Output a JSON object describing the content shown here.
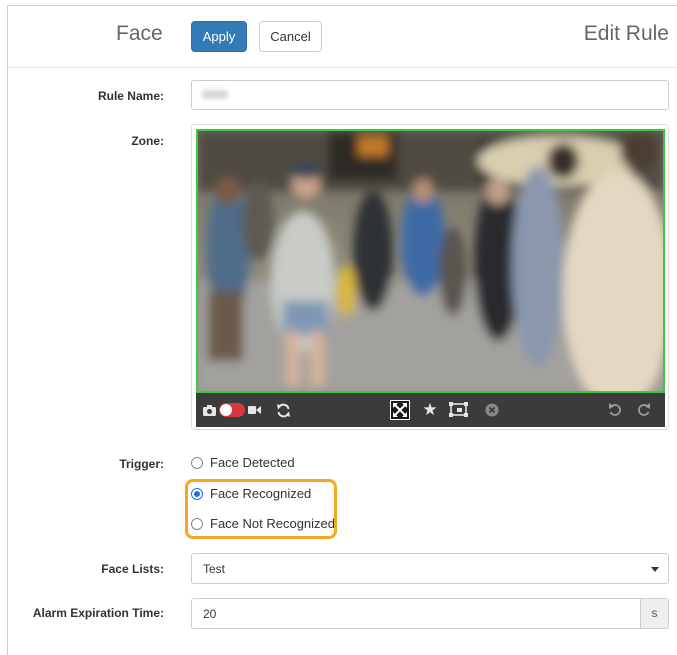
{
  "header": {
    "title": "Face",
    "apply_label": "Apply",
    "cancel_label": "Cancel",
    "mode_title": "Edit Rule"
  },
  "form": {
    "rule_name_label": "Rule Name:",
    "rule_name_value": "",
    "zone_label": "Zone:",
    "trigger_label": "Trigger:",
    "trigger_options": [
      {
        "label": "Face Detected",
        "selected": false
      },
      {
        "label": "Face Recognized",
        "selected": true
      },
      {
        "label": "Face Not Recognized",
        "selected": false
      }
    ],
    "face_lists_label": "Face Lists:",
    "face_lists_value": "Test",
    "alarm_label": "Alarm Expiration Time:",
    "alarm_value": "20",
    "alarm_unit": "s"
  },
  "zone_toolbar": {
    "left_icons": [
      "camera-icon",
      "record-toggle-icon",
      "video-icon",
      "refresh-icon"
    ],
    "center_icons": [
      "fullscreen-icon",
      "star-icon",
      "select-region-icon",
      "clear-icon"
    ],
    "right_icons": [
      "undo-icon",
      "redo-icon"
    ]
  },
  "colors": {
    "primary": "#337ab7",
    "zone_border": "#3ec83e",
    "highlight": "#f5a623",
    "radio_selected": "#1a73e8",
    "toolbar_bg": "#3b3b3b"
  }
}
